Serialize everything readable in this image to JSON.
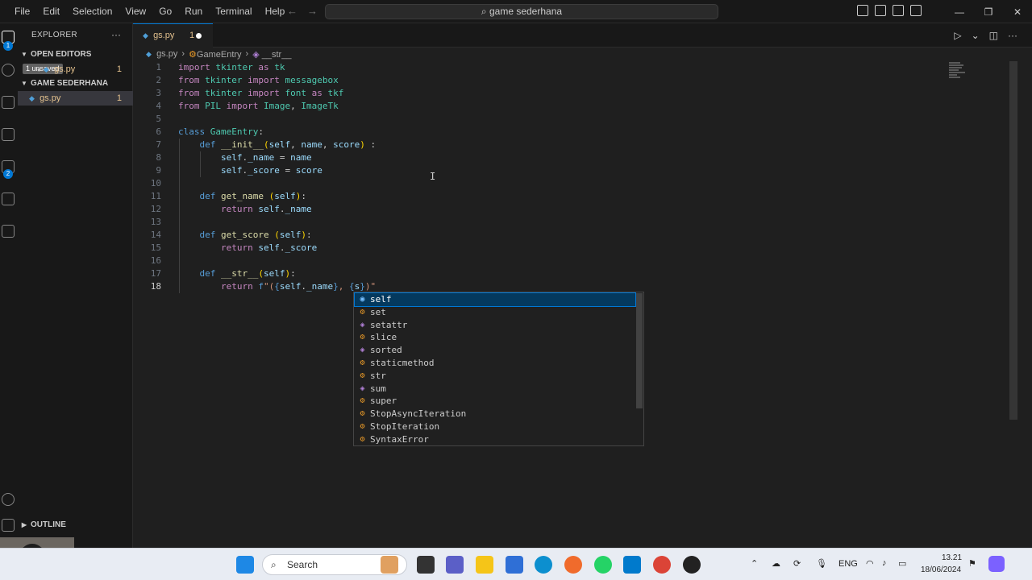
{
  "titlebar": {
    "menu": [
      "File",
      "Edit",
      "Selection",
      "View",
      "Go",
      "Run",
      "Terminal",
      "Help"
    ],
    "search_label": "game sederhana"
  },
  "sidebar": {
    "title": "EXPLORER",
    "more": "···",
    "open_editors": "OPEN EDITORS",
    "unsaved_badge": "1 unsaved",
    "project": "GAME SEDERHANA",
    "file_name": "gs.py",
    "file_problems": "1",
    "outline": "OUTLINE"
  },
  "editor": {
    "tab_label": "gs.py",
    "tab_count": "1",
    "breadcrumb": [
      "gs.py",
      "GameEntry",
      "__str__"
    ],
    "active_line": 18
  },
  "suggestions": [
    {
      "label": "self",
      "kind": "field"
    },
    {
      "label": "set",
      "kind": "class"
    },
    {
      "label": "setattr",
      "kind": "function"
    },
    {
      "label": "slice",
      "kind": "class"
    },
    {
      "label": "sorted",
      "kind": "function"
    },
    {
      "label": "staticmethod",
      "kind": "class"
    },
    {
      "label": "str",
      "kind": "class"
    },
    {
      "label": "sum",
      "kind": "function"
    },
    {
      "label": "super",
      "kind": "class"
    },
    {
      "label": "StopAsyncIteration",
      "kind": "class"
    },
    {
      "label": "StopIteration",
      "kind": "class"
    },
    {
      "label": "SyntaxError",
      "kind": "class"
    }
  ],
  "taskbar": {
    "search": "Search",
    "lang": "ENG",
    "time": "13.21",
    "date": "18/06/2024"
  }
}
